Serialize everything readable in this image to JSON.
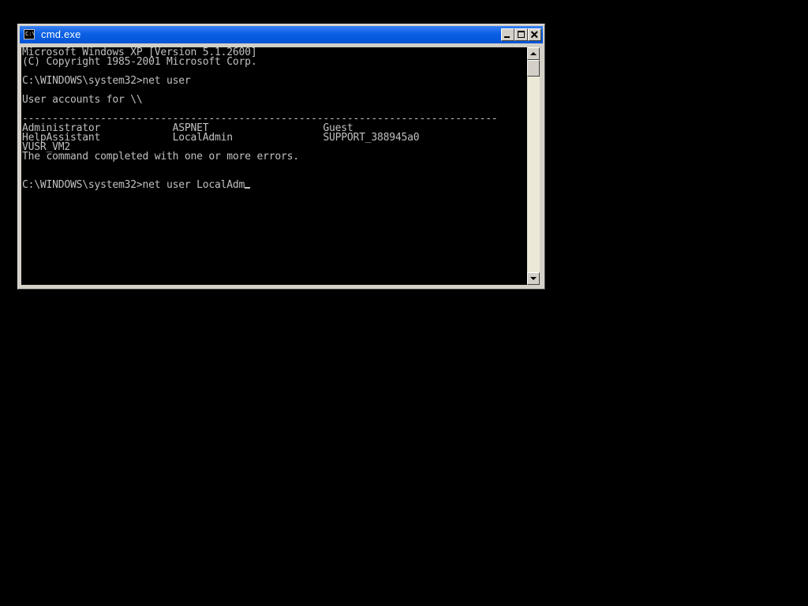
{
  "window": {
    "title": "cmd.exe",
    "icon": "cmd-icon",
    "icon_glyph": "C:\\"
  },
  "titlebar_buttons": [
    "minimize-icon",
    "maximize-icon",
    "close-icon"
  ],
  "console": {
    "lines": [
      "Microsoft Windows XP [Version 5.1.2600]",
      "(C) Copyright 1985-2001 Microsoft Corp.",
      "",
      "C:\\WINDOWS\\system32>net user",
      "",
      "User accounts for \\\\",
      "",
      "-------------------------------------------------------------------------------",
      "Administrator            ASPNET                   Guest",
      "HelpAssistant            LocalAdmin               SUPPORT_388945a0",
      "VUSR_VM2",
      "The command completed with one or more errors.",
      "",
      "",
      "C:\\WINDOWS\\system32>net user LocalAdm"
    ],
    "text_color": "#c0c0c0",
    "background": "#000000"
  },
  "scrollbar": {
    "up": "scroll-up-arrow-icon",
    "down": "scroll-down-arrow-icon"
  },
  "colors": {
    "titlebar": "#0a5fe3",
    "title_text": "#ffffff",
    "desktop": "#000000"
  }
}
